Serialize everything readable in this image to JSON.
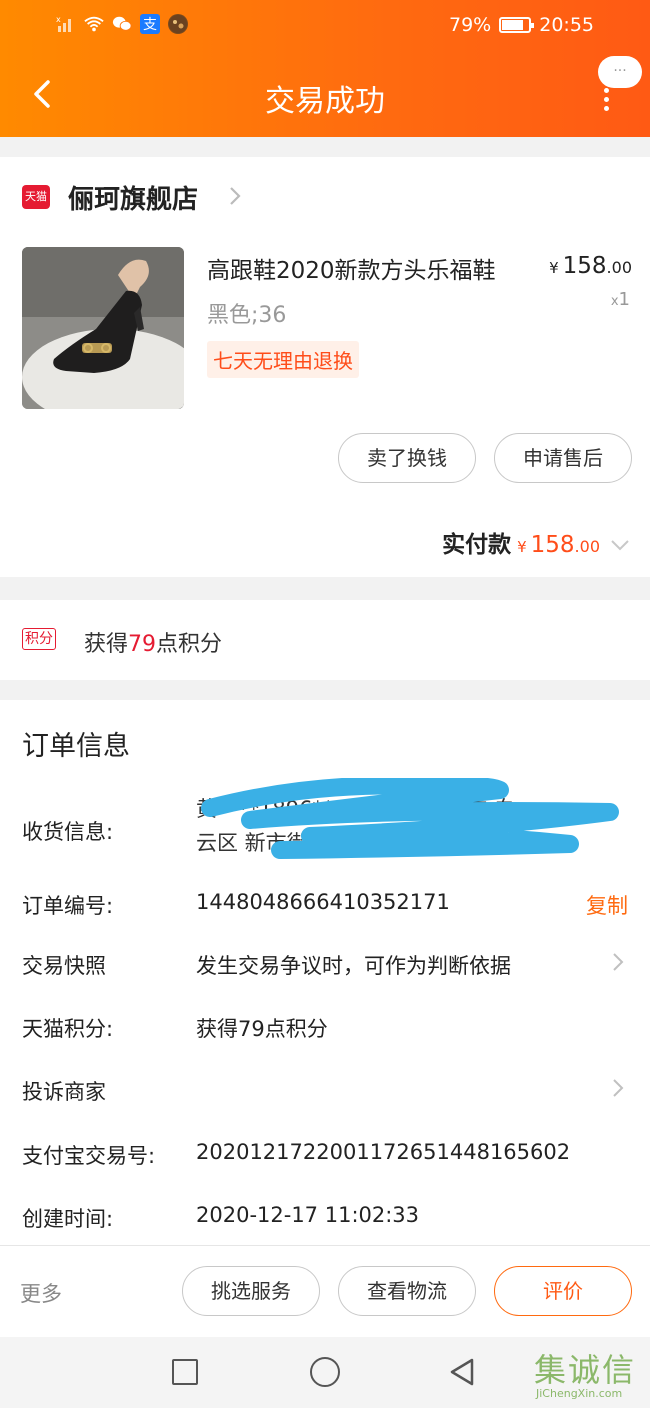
{
  "status_bar": {
    "battery_percent": "79%",
    "battery_level": 0.79,
    "time": "20:55",
    "icons": [
      "no-sim-icon",
      "wifi-icon",
      "wechat-icon",
      "alipay-icon",
      "app-avatar-icon"
    ]
  },
  "header": {
    "title": "交易成功",
    "more_bubble": "···"
  },
  "store": {
    "badge": "天猫",
    "name": "俪珂旗舰店"
  },
  "product": {
    "title": "高跟鞋2020新款方头乐福鞋",
    "price_symbol": "¥",
    "price_main": "158",
    "price_decimal": ".00",
    "qty_x": "x",
    "qty": "1",
    "sku": "黑色;36",
    "return_tag": "七天无理由退换"
  },
  "actions": {
    "sell": "卖了换钱",
    "aftersale": "申请售后"
  },
  "paid": {
    "label": "实付款",
    "symbol": "¥",
    "main": "158",
    "decimal": ".00"
  },
  "points": {
    "badge": "积分",
    "prefix": "获得",
    "number": "79",
    "suffix": "点积分"
  },
  "order": {
    "title": "订单信息",
    "shipping_label": "收货信息:",
    "shipping_line1": "黄****1896****广东省 广州市 白",
    "shipping_line2": "云区 新市街道 ****号 玉指坊",
    "order_no_label": "订单编号:",
    "order_no": "1448048666410352171",
    "copy": "复制",
    "snapshot_label": "交易快照",
    "snapshot_value": "发生交易争议时，可作为判断依据",
    "tmall_points_label": "天猫积分:",
    "tmall_points_value": "获得79点积分",
    "complaint_label": "投诉商家",
    "alipay_label": "支付宝交易号:",
    "alipay_no": "2020121722001172651448165602",
    "created_label": "创建时间:",
    "created_time": "2020-12-17 11:02:33"
  },
  "bottom_bar": {
    "more": "更多",
    "select_service": "挑选服务",
    "logistics": "查看物流",
    "review": "评价"
  },
  "watermark": {
    "cn": "集诚信",
    "en": "JiChengXin.com"
  },
  "colors": {
    "accent_orange": "#ff6a10",
    "tmall_red": "#e51b32",
    "price_orange": "#ff4d1a",
    "redaction_blue": "#3ab0e6"
  }
}
